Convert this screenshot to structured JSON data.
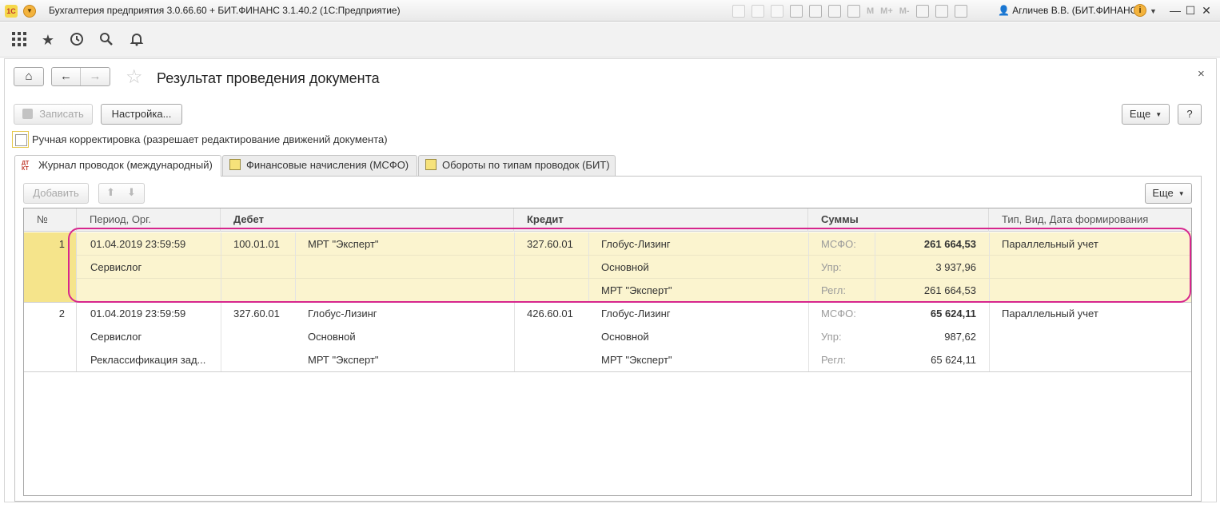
{
  "window": {
    "title": "Бухгалтерия предприятия 3.0.66.60 + БИТ.ФИНАНС 3.1.40.2  (1С:Предприятие)",
    "logo_text": "1С",
    "toolbar_labels": [
      "M",
      "M+",
      "M-"
    ],
    "user": "Агличев В.В. (БИТ.ФИНАНС)",
    "info_label": "i",
    "controls": {
      "minimize": "—",
      "maximize": "☐",
      "close": "✕"
    }
  },
  "section_icons": [
    "apps-grid-icon",
    "favorites-star-icon",
    "history-icon",
    "search-icon",
    "notifications-bell-icon"
  ],
  "form": {
    "title": "Результат проведения документа",
    "close_label": "×",
    "nav": {
      "home": "⌂",
      "back": "←",
      "forward": "→"
    },
    "buttons": {
      "save": "Записать",
      "settings": "Настройка...",
      "more": "Еще",
      "help": "?"
    },
    "manual_edit": {
      "label": "Ручная корректировка (разрешает редактирование движений документа)",
      "checked": false
    },
    "tabs": [
      {
        "label": "Журнал проводок (международный)",
        "icon": "dt-kt-icon",
        "active": true
      },
      {
        "label": "Финансовые начисления (МСФО)",
        "icon": "document-icon",
        "active": false
      },
      {
        "label": "Обороты по типам проводок (БИТ)",
        "icon": "document-icon",
        "active": false
      }
    ],
    "table_toolbar": {
      "add": "Добавить",
      "more": "Еще"
    },
    "columns": {
      "num": "№",
      "period": "Период, Орг.",
      "debit": "Дебет",
      "credit": "Кредит",
      "sums": "Суммы",
      "type": "Тип, Вид, Дата формирования"
    },
    "rows": [
      {
        "num": "1",
        "period": "01.04.2019 23:59:59",
        "org": "Сервислог",
        "org2": "",
        "debit_account": "100.01.01",
        "debit_sub": [
          "МРТ \"Эксперт\"",
          "",
          ""
        ],
        "credit_account": "327.60.01",
        "credit_sub": [
          "Глобус-Лизинг",
          "Основной",
          "МРТ \"Эксперт\""
        ],
        "sums": [
          {
            "label": "МСФО:",
            "value": "261 664,53"
          },
          {
            "label": "Упр:",
            "value": "3 937,96"
          },
          {
            "label": "Регл:",
            "value": "261 664,53"
          }
        ],
        "type": "Параллельный учет"
      },
      {
        "num": "2",
        "period": "01.04.2019 23:59:59",
        "org": "Сервислог",
        "org2": "Реклассификация зад...",
        "debit_account": "327.60.01",
        "debit_sub": [
          "Глобус-Лизинг",
          "Основной",
          "МРТ \"Эксперт\""
        ],
        "credit_account": "426.60.01",
        "credit_sub": [
          "Глобус-Лизинг",
          "Основной",
          "МРТ \"Эксперт\""
        ],
        "sums": [
          {
            "label": "МСФО:",
            "value": "65 624,11"
          },
          {
            "label": "Упр:",
            "value": "987,62"
          },
          {
            "label": "Регл:",
            "value": "65 624,11"
          }
        ],
        "type": "Параллельный учет"
      }
    ]
  }
}
